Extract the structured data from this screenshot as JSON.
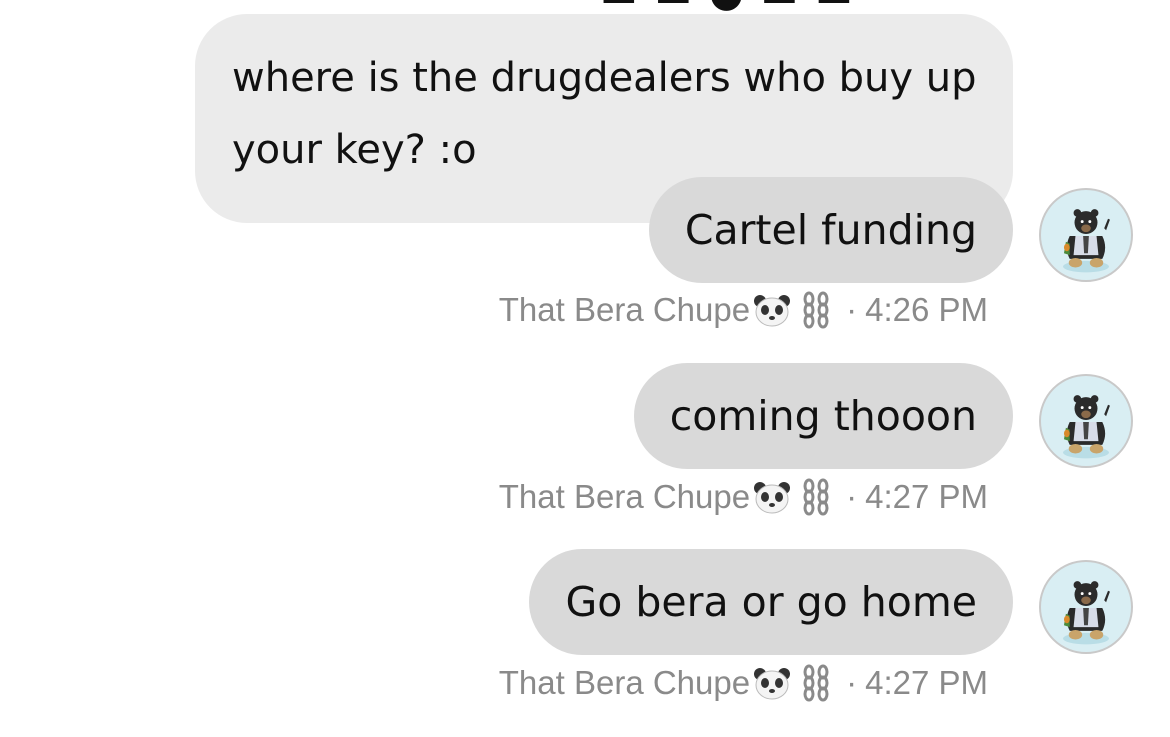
{
  "conversation": {
    "received": {
      "text": "where is the drugdealers who buy up your key? :o"
    },
    "sent": [
      {
        "text": "Cartel funding",
        "sender": "That Bera Chupe",
        "separator": "·",
        "time": "4:26 PM"
      },
      {
        "text": "coming thooon",
        "sender": "That Bera Chupe",
        "separator": "·",
        "time": "4:27 PM"
      },
      {
        "text": "Go bera or go home",
        "sender": "That Bera Chupe",
        "separator": "·",
        "time": "4:27 PM"
      }
    ],
    "sender_emojis": [
      "panda-emoji-icon",
      "chain-emoji-icon"
    ],
    "avatar": {
      "icon": "bear-avatar-icon",
      "background": "#d9eef3"
    }
  },
  "colors": {
    "received_bubble": "#ebebeb",
    "sent_bubble": "#d9d9d9",
    "meta_text": "#8a8a8a"
  }
}
